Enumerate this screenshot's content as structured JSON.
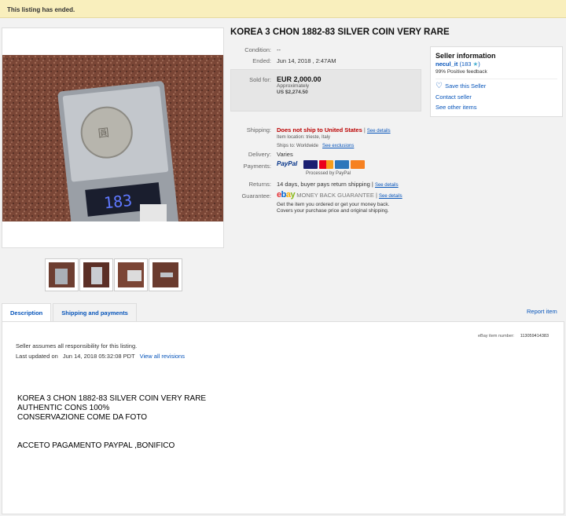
{
  "banner": {
    "text": "This listing has ended."
  },
  "item": {
    "title": "KOREA 3 CHON 1882-83 SILVER COIN VERY RARE",
    "condition_label": "Condition:",
    "condition_value": "--",
    "ended_label": "Ended:",
    "ended_value": "Jun 14, 2018 , 2:47AM",
    "sold_label": "Sold for:",
    "sold_price": "EUR 2,000.00",
    "approx_label": "Approximately",
    "approx_price": "US $2,274.50",
    "shipping_label": "Shipping:",
    "shipping_value": "Does not ship to United States",
    "shipping_details": "See details",
    "item_location": "Item location:  trieste, Italy",
    "ships_to": "Ships to:  Worldwide",
    "see_exclusions": "See exclusions",
    "delivery_label": "Delivery:",
    "delivery_value": "Varies",
    "payments_label": "Payments:",
    "paypal": "PayPal",
    "card_labels": [
      "VISA",
      "MC",
      "AMEX",
      "DISCOVER"
    ],
    "processed_by": "Processed by PayPal",
    "returns_label": "Returns:",
    "returns_value": "14 days, buyer pays return shipping |",
    "returns_details": "See details",
    "guarantee_label": "Guarantee:",
    "guarantee_logo": "ebay",
    "guarantee_text": "MONEY BACK GUARANTEE",
    "guarantee_details": "See details",
    "guarantee_desc1": "Get the item you ordered or get your money back.",
    "guarantee_desc2": "Covers your purchase price and original shipping."
  },
  "seller": {
    "heading": "Seller information",
    "name": "necul_it",
    "score": "(183",
    "feedback": "99% Positive feedback",
    "save": "Save this Seller",
    "contact": "Contact seller",
    "other": "See other items"
  },
  "tabs": {
    "description": "Description",
    "shipping": "Shipping and payments",
    "report": "Report item"
  },
  "description": {
    "responsibility": "Seller assumes all responsibility for this listing.",
    "updated_label": "Last updated on",
    "updated_value": "Jun 14, 2018 05:32:08 PDT",
    "revisions": "View all revisions",
    "item_number_label": "eBay item number:",
    "item_number": "113059414383",
    "line1": "KOREA 3 CHON 1882-83 SILVER COIN VERY RARE",
    "line2": "AUTHENTIC CONS 100%",
    "line3": "CONSERVAZIONE COME DA FOTO",
    "line4": "ACCETO PAGAMENTO PAYPAL ,BONIFICO"
  },
  "scale_display": "183"
}
